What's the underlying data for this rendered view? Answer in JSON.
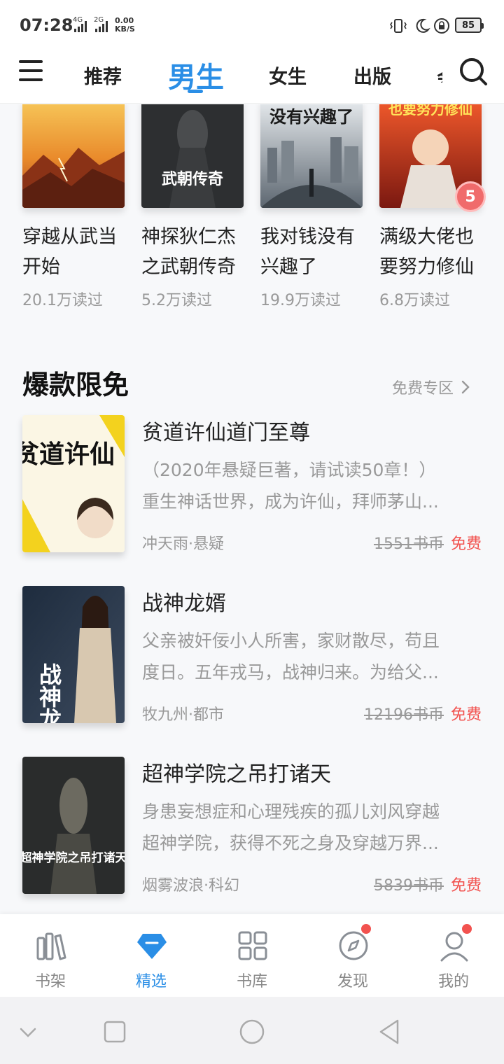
{
  "status_bar": {
    "time": "07:28",
    "sim1": "4G",
    "sim2": "2G",
    "speed_value": "0.00",
    "speed_unit": "KB/S",
    "battery": "85"
  },
  "header": {
    "tabs": [
      {
        "label": "推荐",
        "active": false
      },
      {
        "label": "男生",
        "active": true
      },
      {
        "label": "女生",
        "active": false
      },
      {
        "label": "出版",
        "active": false
      }
    ],
    "clipped_tab": "会",
    "accent_color": "#2a8ee6"
  },
  "grid_books": [
    {
      "title_line1": "穿越从武当",
      "title_line2": "开始",
      "reads": "20.1万读过"
    },
    {
      "title_line1": "神探狄仁杰",
      "title_line2": "之武朝传奇",
      "reads": "5.2万读过",
      "cover_text": "武朝传奇"
    },
    {
      "title_line1": "我对钱没有",
      "title_line2": "兴趣了",
      "reads": "19.9万读过",
      "cover_text": "没有兴趣了"
    },
    {
      "title_line1": "满级大佬也",
      "title_line2": "要努力修仙",
      "reads": "6.8万读过",
      "cover_text": "也要努力修仙"
    }
  ],
  "floating_badge": "5",
  "section": {
    "title": "爆款限免",
    "more": "免费专区"
  },
  "books": [
    {
      "title": "贫道许仙道门至尊",
      "desc_line1": "（2020年悬疑巨著，请试读50章！）",
      "desc_line2": "重生神话世界，成为许仙，拜师茅山...",
      "meta": "冲天雨·悬疑",
      "old_price": "1551书币",
      "free": "免费",
      "cover_text": "贫道许仙"
    },
    {
      "title": "战神龙婿",
      "desc_line1": "父亲被奸佞小人所害，家财散尽，苟且",
      "desc_line2": "度日。五年戎马，战神归来。为给父...",
      "meta": "牧九州·都市",
      "old_price": "12196书币",
      "free": "免费",
      "cover_text": "战神龙婿"
    },
    {
      "title": "超神学院之吊打诸天",
      "desc_line1": "身患妄想症和心理残疾的孤儿刘风穿越",
      "desc_line2": "超神学院，获得不死之身及穿越万界...",
      "meta": "烟雾波浪·科幻",
      "old_price": "5839书币",
      "free": "免费",
      "cover_text": "超神学院之吊打诸天"
    }
  ],
  "bottom_nav": [
    {
      "label": "书架",
      "icon": "bookshelf-icon",
      "active": false
    },
    {
      "label": "精选",
      "icon": "diamond-icon",
      "active": true
    },
    {
      "label": "书库",
      "icon": "grid-icon",
      "active": false
    },
    {
      "label": "发现",
      "icon": "compass-icon",
      "active": false,
      "dot": true
    },
    {
      "label": "我的",
      "icon": "person-icon",
      "active": false,
      "dot": true
    }
  ],
  "colors": {
    "accent": "#2a8ee6",
    "free_red": "#f2524f",
    "muted": "#999999"
  }
}
